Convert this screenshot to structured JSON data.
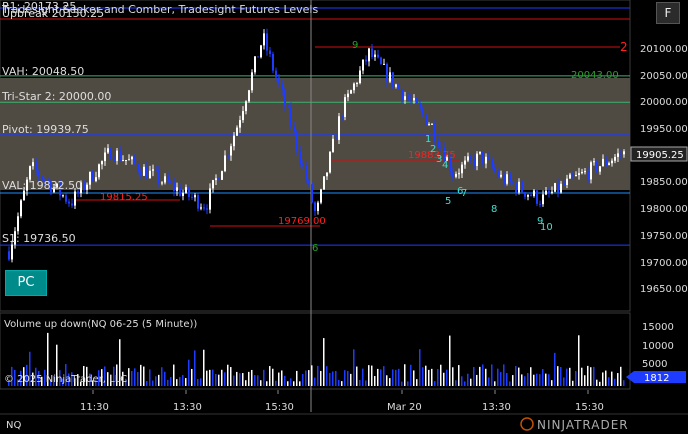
{
  "window": {
    "title": "Tradesight Seeker and Comber, Tradesight Futures Levels",
    "f_button": "F",
    "pc_button": "PC"
  },
  "top_labels": {
    "r1": "R1: 20173.25",
    "upbreak": "Upbreak 20150.25"
  },
  "levels": [
    {
      "label": "VAH: 20048.50",
      "value": 20048.5,
      "color": "#3cb371"
    },
    {
      "label": "Tri-Star 2: 20000.00",
      "value": 20000,
      "color": "#3cb371"
    },
    {
      "label": "Pivot: 19939.75",
      "value": 19939.75,
      "color": "#1e3cff"
    },
    {
      "label": "VAL: 19832.50",
      "value": 19832.5,
      "color": "#1e90ff"
    },
    {
      "label": "S1: 19736.50",
      "value": 19736.5,
      "color": "#1e3cff"
    }
  ],
  "annotations": [
    {
      "text": "19815.25",
      "color": "#ff2020"
    },
    {
      "text": "19769.00",
      "color": "#ff2020"
    },
    {
      "text": "19883.75",
      "color": "#ff2020"
    },
    {
      "text": "20043.00",
      "color": "#2aa02a"
    },
    {
      "text": "2",
      "color": "#ff2020"
    }
  ],
  "seq_numbers": [
    "1",
    "2",
    "3",
    "4",
    "5",
    "6",
    "7",
    "8",
    "9",
    "10",
    "6",
    "9"
  ],
  "price_axis": {
    "ticks": [
      "20100.00",
      "20050.00",
      "20000.00",
      "19950.00",
      "19900.00",
      "19850.00",
      "19800.00",
      "19750.00",
      "19700.00",
      "19650.00"
    ],
    "current": "19905.25"
  },
  "volume_panel": {
    "title": "Volume up down(NQ 06-25 (5 Minute))",
    "ticks": [
      "15000",
      "10000",
      "5000"
    ],
    "current": "1812",
    "copyright": "© 2025 NinjaTrader, LLC"
  },
  "time_axis": {
    "labels": [
      "11:30",
      "13:30",
      "15:30",
      "Mar 20",
      "13:30",
      "15:30"
    ]
  },
  "status": {
    "instrument": "NQ",
    "brand": "NINJATRADER"
  },
  "colors": {
    "up": "#ffffff",
    "down": "#1e3cff",
    "value_area": "#555047"
  }
}
